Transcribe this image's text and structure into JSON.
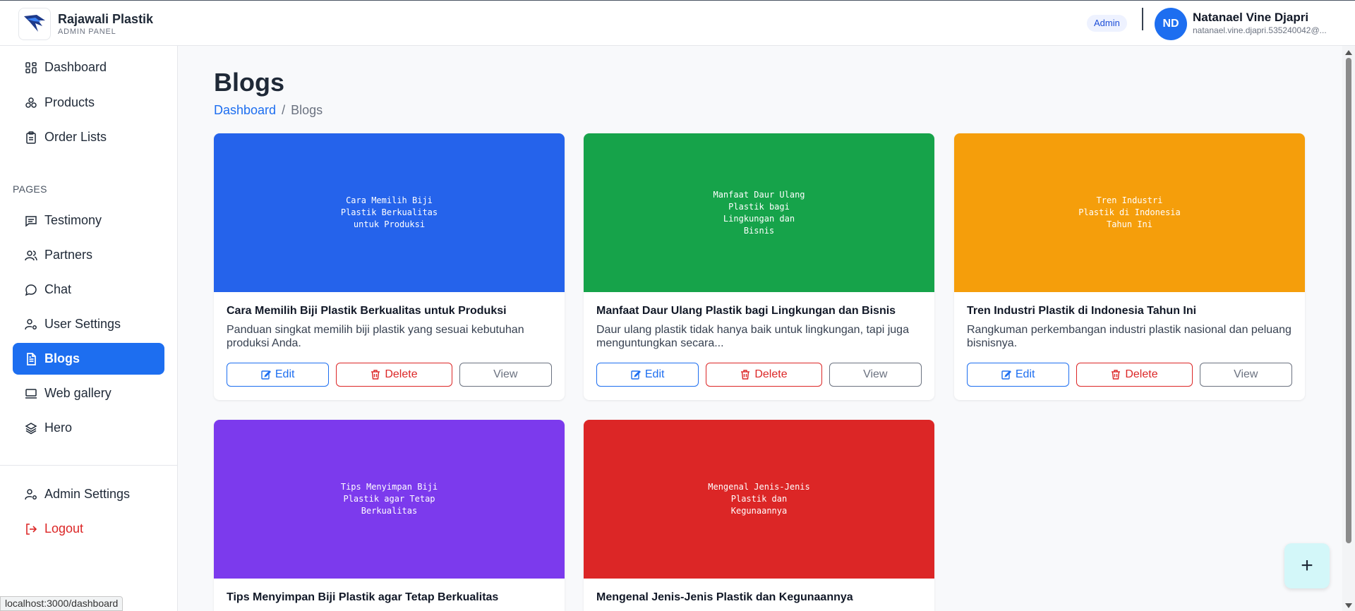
{
  "brand": {
    "name": "Rajawali Plastik",
    "subtitle": "ADMIN PANEL"
  },
  "header": {
    "role": "Admin",
    "user_initials": "ND",
    "user_name": "Natanael Vine Djapri",
    "user_email": "natanael.vine.djapri.535240042@..."
  },
  "sidebar": {
    "items": [
      {
        "label": "Dashboard",
        "icon": "dashboard-icon"
      },
      {
        "label": "Products",
        "icon": "products-icon"
      },
      {
        "label": "Order Lists",
        "icon": "clipboard-icon"
      }
    ],
    "section_label": "PAGES",
    "pages": [
      {
        "label": "Testimony",
        "icon": "message-square-icon"
      },
      {
        "label": "Partners",
        "icon": "users-icon"
      },
      {
        "label": "Chat",
        "icon": "chat-bubble-icon"
      },
      {
        "label": "User Settings",
        "icon": "user-cog-icon"
      },
      {
        "label": "Blogs",
        "icon": "file-text-icon",
        "active": true
      },
      {
        "label": "Web gallery",
        "icon": "monitor-icon"
      },
      {
        "label": "Hero",
        "icon": "layers-icon"
      }
    ],
    "bottom": [
      {
        "label": "Admin Settings",
        "icon": "user-cog-icon"
      },
      {
        "label": "Logout",
        "icon": "logout-icon"
      }
    ]
  },
  "page": {
    "title": "Blogs",
    "breadcrumb": {
      "home": "Dashboard",
      "separator": "/",
      "current": "Blogs"
    }
  },
  "buttons": {
    "edit": "Edit",
    "delete": "Delete",
    "view": "View"
  },
  "blogs": [
    {
      "image_text": "Cara Memilih Biji Plastik Berkualitas untuk Produksi",
      "color": "#2563eb",
      "title": "Cara Memilih Biji Plastik Berkualitas untuk Produksi",
      "description": "Panduan singkat memilih biji plastik yang sesuai kebutuhan produksi Anda."
    },
    {
      "image_text": "Manfaat Daur Ulang Plastik bagi Lingkungan dan Bisnis",
      "color": "#16a34a",
      "title": "Manfaat Daur Ulang Plastik bagi Lingkungan dan Bisnis",
      "description": "Daur ulang plastik tidak hanya baik untuk lingkungan, tapi juga menguntungkan secara..."
    },
    {
      "image_text": "Tren Industri Plastik di Indonesia Tahun Ini",
      "color": "#f59e0b",
      "title": "Tren Industri Plastik di Indonesia Tahun Ini",
      "description": "Rangkuman perkembangan industri plastik nasional dan peluang bisnisnya."
    },
    {
      "image_text": "Tips Menyimpan Biji Plastik agar Tetap Berkualitas",
      "color": "#7c3aed",
      "title": "Tips Menyimpan Biji Plastik agar Tetap Berkualitas",
      "description": ""
    },
    {
      "image_text": "Mengenal Jenis-Jenis Plastik dan Kegunaannya",
      "color": "#dc2626",
      "title": "Mengenal Jenis-Jenis Plastik dan Kegunaannya",
      "description": ""
    }
  ],
  "fab_label": "+",
  "status_url": "localhost:3000/dashboard"
}
